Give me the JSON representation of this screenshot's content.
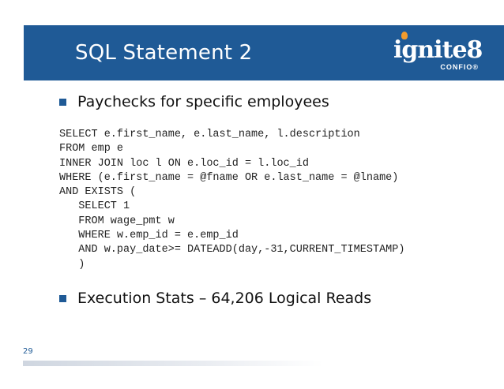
{
  "slide": {
    "title": "SQL Statement 2",
    "page_number": "29"
  },
  "logo": {
    "main": "ignite8",
    "sub": "CONFIO®"
  },
  "bullets": [
    "Paychecks for specific employees",
    "Execution Stats – 64,206 Logical Reads"
  ],
  "code_lines": [
    "SELECT e.first_name, e.last_name, l.description",
    "FROM emp e",
    "INNER JOIN loc l ON e.loc_id = l.loc_id",
    "WHERE (e.first_name = @fname OR e.last_name = @lname)",
    "AND EXISTS (",
    "   SELECT 1",
    "   FROM wage_pmt w",
    "   WHERE w.emp_id = e.emp_id",
    "   AND w.pay_date>= DATEADD(day,-31,CURRENT_TIMESTAMP)",
    "   )"
  ],
  "colors": {
    "header": "#1f5a96",
    "bullet": "#1f5a96",
    "logo_accent": "#f39c2d"
  }
}
